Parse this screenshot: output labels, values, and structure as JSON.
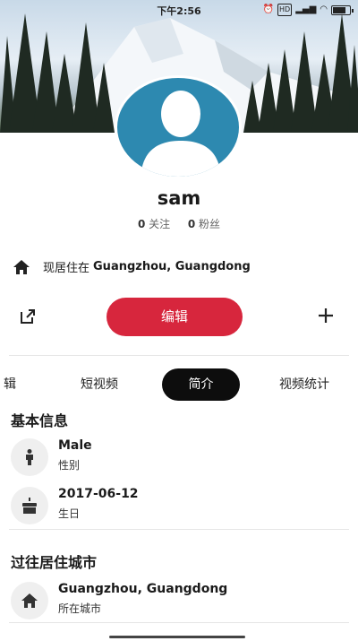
{
  "status_bar": {
    "time": "下午2:56",
    "icons": [
      "alarm-icon",
      "bluetooth-icon",
      "hd-icon",
      "signal-icon",
      "wifi-icon",
      "battery-icon"
    ],
    "battery_level": 0.85
  },
  "profile": {
    "username": "sam",
    "following_count": "0",
    "following_label": "关注",
    "followers_count": "0",
    "followers_label": "粉丝",
    "residence_prefix": "现居住在",
    "residence_city": "Guangzhou, Guangdong"
  },
  "actions": {
    "edit_label": "编辑"
  },
  "tabs": [
    {
      "label": "辑"
    },
    {
      "label": "短视频"
    },
    {
      "label": "简介",
      "active": true
    },
    {
      "label": "视频统计"
    }
  ],
  "basic_info": {
    "title": "基本信息",
    "rows": [
      {
        "value": "Male",
        "label": "性别",
        "icon": "person-icon"
      },
      {
        "value": "2017-06-12",
        "label": "生日",
        "icon": "cake-icon"
      }
    ]
  },
  "past_cities": {
    "title": "过往居住城市",
    "rows": [
      {
        "value": "Guangzhou, Guangdong",
        "label": "所在城市",
        "icon": "home-icon"
      }
    ]
  },
  "colors": {
    "accent": "#d7263d",
    "avatar_bg": "#2d89b0",
    "active_tab_bg": "#0d0d0d"
  }
}
